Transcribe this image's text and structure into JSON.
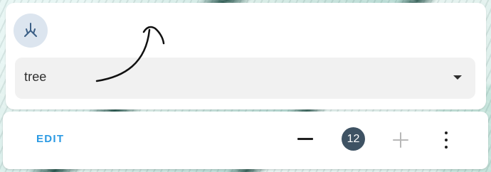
{
  "select": {
    "value": "tree"
  },
  "toolbar": {
    "edit_label": "EDIT",
    "count": "12"
  },
  "icons": {
    "top": "tree-branch-icon",
    "minus": "minus-icon",
    "plus": "plus-icon",
    "more": "more-vertical-icon",
    "dropdown": "chevron-down-icon"
  },
  "colors": {
    "accent": "#2b9ae3",
    "badge": "#3e5263",
    "icon_circle": "#dce5ef",
    "select_background": "#f1f1f1"
  }
}
